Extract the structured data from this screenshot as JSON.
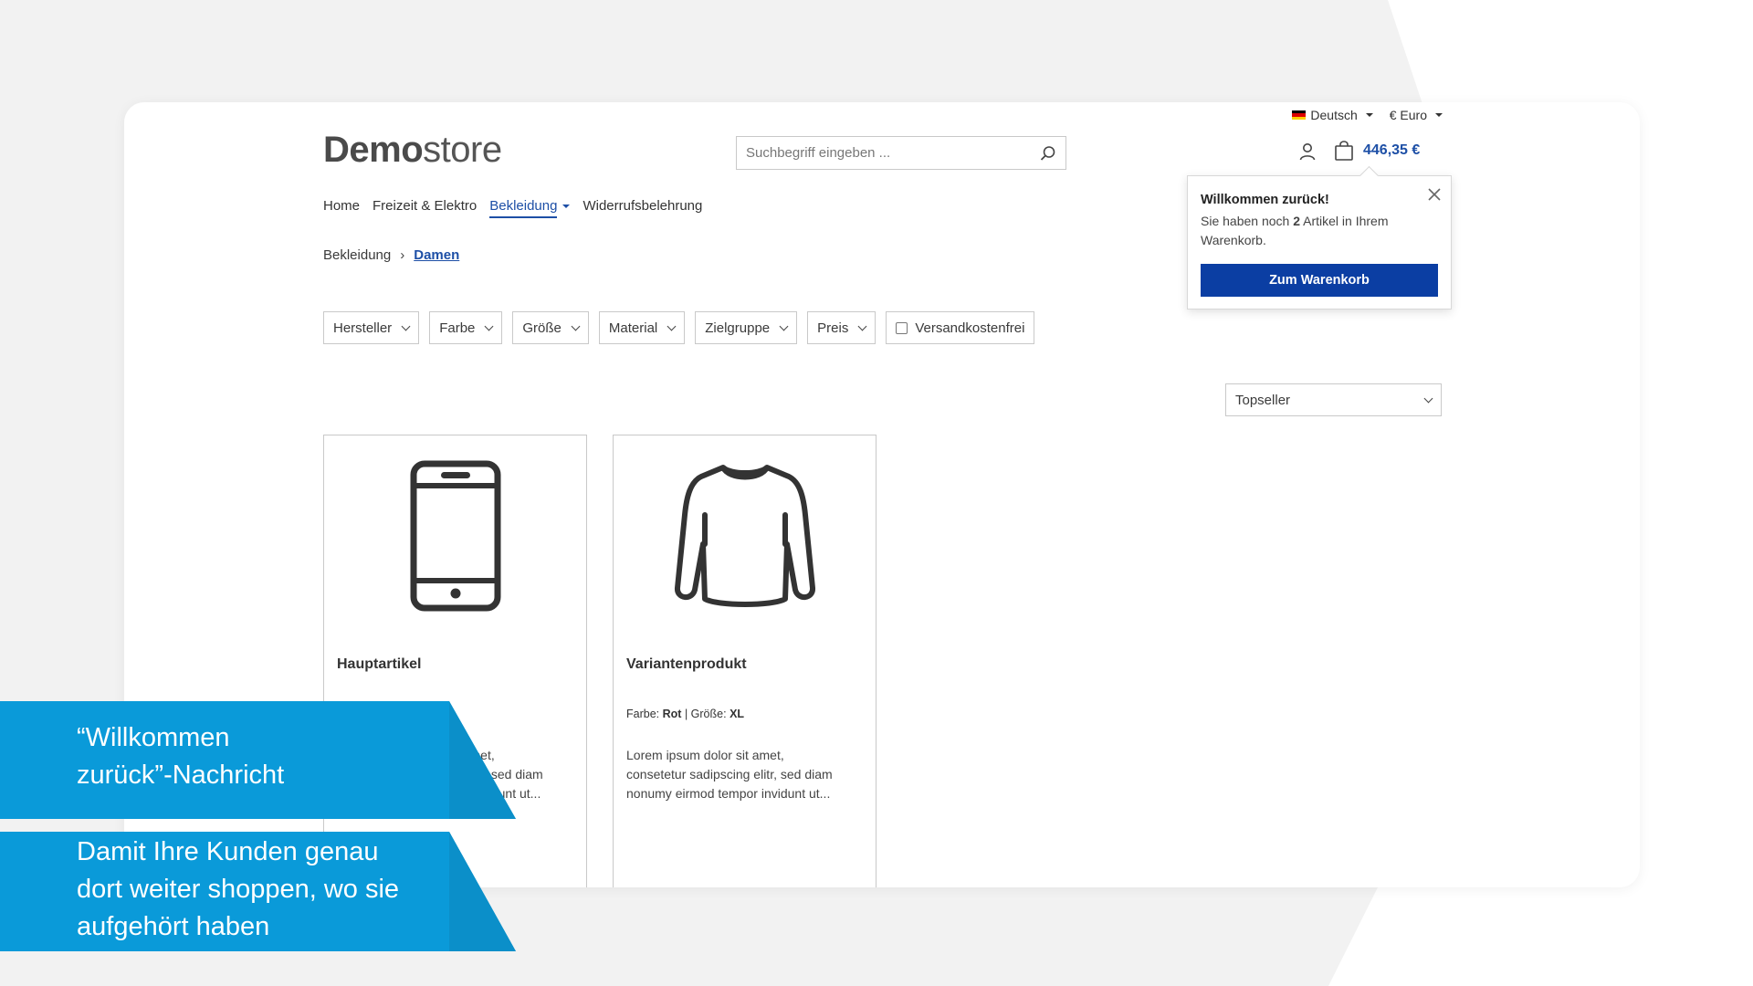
{
  "colors": {
    "accent": "#1d4fa6",
    "button": "#0b3ea3",
    "banner": "#0a9ad9",
    "background": "#f2f2f2"
  },
  "topbar": {
    "language": "Deutsch",
    "currency": "€ Euro"
  },
  "header": {
    "logo_bold": "Demo",
    "logo_light": "store",
    "search_placeholder": "Suchbegriff eingeben ...",
    "account_icon": "user-icon",
    "cart_icon": "bag-icon",
    "cart_total": "446,35 €"
  },
  "nav": {
    "items": [
      {
        "label": "Home"
      },
      {
        "label": "Freizeit & Elektro"
      },
      {
        "label": "Bekleidung"
      },
      {
        "label": "Widerrufsbelehrung"
      }
    ]
  },
  "breadcrumb": {
    "parent": "Bekleidung",
    "separator": "›",
    "current": "Damen"
  },
  "filters": {
    "items": [
      {
        "label": "Hersteller"
      },
      {
        "label": "Farbe"
      },
      {
        "label": "Größe"
      },
      {
        "label": "Material"
      },
      {
        "label": "Zielgruppe"
      },
      {
        "label": "Preis"
      }
    ],
    "checkbox_label": "Versandkostenfrei"
  },
  "sort": {
    "selected": "Topseller"
  },
  "products": [
    {
      "name": "Hauptartikel",
      "icon": "smartphone-icon",
      "description_lines": [
        "Lorem ipsum dolor sit amet,",
        "consetetur sadipscing elitr, sed diam",
        "nonumy eirmod tempor invidunt ut..."
      ]
    },
    {
      "name": "Variantenprodukt",
      "icon": "sweater-icon",
      "variant_color_label": "Farbe:",
      "variant_color": "Rot",
      "variant_sep": "|",
      "variant_size_label": "Größe:",
      "variant_size": "XL",
      "description_lines": [
        "Lorem ipsum dolor sit amet,",
        "consetetur sadipscing elitr, sed diam",
        "nonumy eirmod tempor invidunt ut..."
      ]
    }
  ],
  "popup": {
    "title": "Willkommen zurück!",
    "text_before": "Sie haben noch ",
    "count": "2",
    "text_after": " Artikel in Ihrem Warenkorb.",
    "button": "Zum Warenkorb"
  },
  "banners": {
    "first": [
      "“Willkommen",
      "zurück”-Nachricht"
    ],
    "second": [
      "Damit Ihre Kunden genau",
      "dort weiter shoppen, wo sie",
      "aufgehört haben"
    ]
  }
}
